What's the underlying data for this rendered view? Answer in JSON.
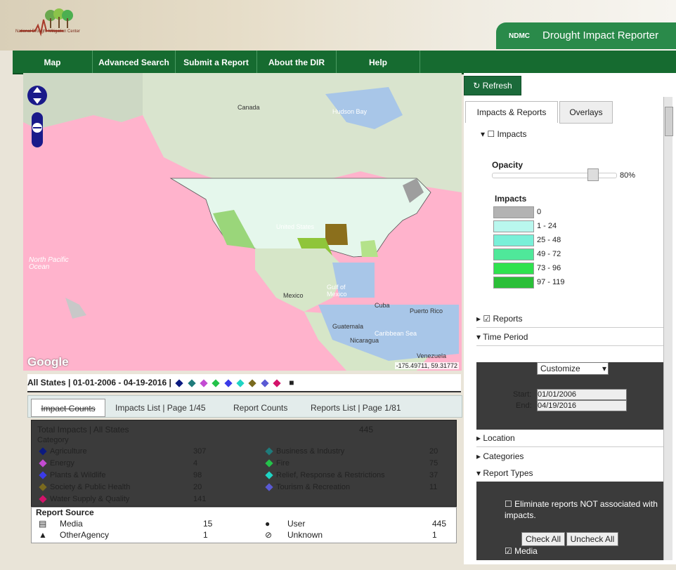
{
  "header": {
    "logo_text": "National Drought Mitigation Center",
    "ndmc": "NDMC",
    "title": "Drought Impact Reporter"
  },
  "nav": [
    "Map",
    "Advanced Search",
    "Submit a Report",
    "About the DIR",
    "Help"
  ],
  "map": {
    "labels": {
      "canada": "Canada",
      "hudson": "Hudson Bay",
      "mexico": "Mexico",
      "gulf": "Gulf of Mexico",
      "cuba": "Cuba",
      "puerto": "Puerto Rico",
      "guatemala": "Guatemala",
      "nicaragua": "Nicaragua",
      "venezuela": "Venezuela",
      "caribbean": "Caribbean Sea",
      "us": "United States",
      "ocean": "North Pacific Ocean"
    },
    "google": "Google",
    "coords": "-175.49711, 59.31772"
  },
  "summary": {
    "text": "All States | 01-01-2006 - 04-19-2016 |"
  },
  "tabs": [
    "Impact Counts",
    "Impacts List | Page 1/45",
    "Report Counts",
    "Reports List | Page 1/81"
  ],
  "impacts": {
    "header": "Total Impacts | All States",
    "total": "445",
    "category_label": "Category",
    "left": [
      {
        "name": "Agriculture",
        "count": "307",
        "color": "#0b1a80"
      },
      {
        "name": "Energy",
        "count": "4",
        "color": "#c34bd2"
      },
      {
        "name": "Plants & Wildlife",
        "count": "98",
        "color": "#3b3be8"
      },
      {
        "name": "Society & Public Health",
        "count": "20",
        "color": "#7a6a1f"
      },
      {
        "name": "Water Supply & Quality",
        "count": "141",
        "color": "#d4136a"
      }
    ],
    "right": [
      {
        "name": "Business & Industry",
        "count": "20",
        "color": "#1f7b7b"
      },
      {
        "name": "Fire",
        "count": "75",
        "color": "#24c24a"
      },
      {
        "name": "Relief, Response & Restrictions",
        "count": "37",
        "color": "#1ed4c4"
      },
      {
        "name": "Tourism & Recreation",
        "count": "11",
        "color": "#5a5ad4"
      }
    ]
  },
  "source": {
    "title": "Report Source",
    "rows": [
      {
        "name": "Media",
        "count": "15",
        "name2": "User",
        "count2": "445"
      },
      {
        "name": "OtherAgency",
        "count": "1",
        "name2": "Unknown",
        "count2": "1"
      }
    ]
  },
  "sidebar": {
    "refresh": "Refresh",
    "tabs": [
      "Impacts & Reports",
      "Overlays"
    ],
    "impacts_label": "Impacts",
    "opacity_label": "Opacity",
    "opacity_value": "80%",
    "opacity_fraction": 0.8,
    "legend_title": "Impacts",
    "legend": [
      {
        "range": "0",
        "color": "#b3b3b3"
      },
      {
        "range": "1 - 24",
        "color": "#b9f7ee"
      },
      {
        "range": "25 - 48",
        "color": "#79f0d8"
      },
      {
        "range": "49 - 72",
        "color": "#4fe89a"
      },
      {
        "range": "73 - 96",
        "color": "#2fe24e"
      },
      {
        "range": "97 - 119",
        "color": "#2bbf38"
      }
    ],
    "reports_label": "Reports",
    "time_period": "Time Period",
    "customize": "Customize",
    "start_label": "Start:",
    "start_value": "01/01/2006",
    "end_label": "End:",
    "end_value": "04/19/2016",
    "location": "Location",
    "categories": "Categories",
    "report_types": "Report Types",
    "eliminate": "Eliminate reports NOT associated with impacts.",
    "check_all": "Check All",
    "uncheck_all": "Uncheck All",
    "media": "Media"
  }
}
